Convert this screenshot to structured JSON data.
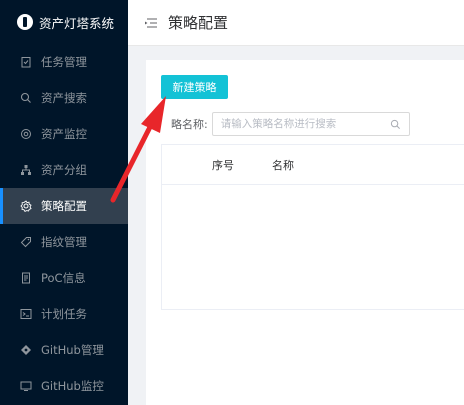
{
  "app": {
    "title": "资产灯塔系统"
  },
  "sidebar": {
    "items": [
      {
        "label": "任务管理",
        "icon": "clipboard-icon"
      },
      {
        "label": "资产搜索",
        "icon": "search-icon"
      },
      {
        "label": "资产监控",
        "icon": "target-icon"
      },
      {
        "label": "资产分组",
        "icon": "hierarchy-icon"
      },
      {
        "label": "策略配置",
        "icon": "gear-icon",
        "active": true
      },
      {
        "label": "指纹管理",
        "icon": "tag-icon"
      },
      {
        "label": "PoC信息",
        "icon": "document-icon"
      },
      {
        "label": "计划任务",
        "icon": "terminal-icon"
      },
      {
        "label": "GitHub管理",
        "icon": "diamond-icon"
      },
      {
        "label": "GitHub监控",
        "icon": "monitor-icon"
      }
    ]
  },
  "header": {
    "title": "策略配置",
    "fold_icon": "fold-icon"
  },
  "main": {
    "new_button": "新建策略",
    "search": {
      "label": "略名称:",
      "placeholder": "请输入策略名称进行搜索"
    },
    "table": {
      "columns": [
        "序号",
        "名称"
      ]
    }
  },
  "colors": {
    "sidebar_bg": "#001529",
    "accent": "#13c2d6",
    "active_bg": "#32404f",
    "arrow": "#e8262a"
  }
}
